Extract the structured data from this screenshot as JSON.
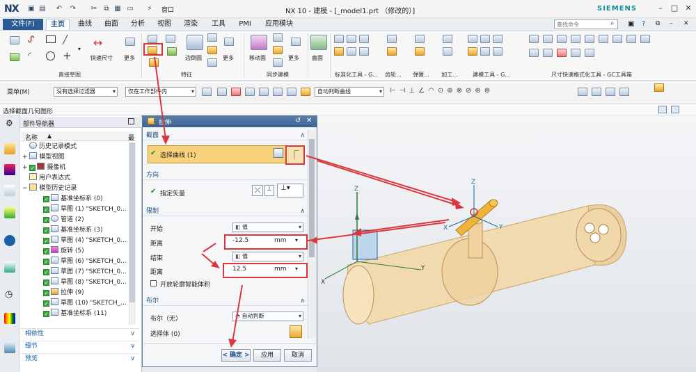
{
  "titlebar": {
    "logo": "NX",
    "title": "NX 10 - 建模 - [_model1.prt （修改的）]",
    "brand": "SIEMENS",
    "window_menu": "窗口"
  },
  "menu": {
    "file": "文件(F)",
    "tabs": [
      "主页",
      "曲线",
      "曲面",
      "分析",
      "视图",
      "渲染",
      "工具",
      "PMI",
      "应用模块"
    ],
    "search_placeholder": "查找命令"
  },
  "ribbon": {
    "groups": [
      "直接草图",
      "特征",
      "同步建模",
      "标准化工具 - G...",
      "齿轮...",
      "弹簧...",
      "加工...",
      "建模工具 - G...",
      "尺寸快速格式化工具 - GC工具箱"
    ],
    "labels": {
      "quick_dim": "快速尺寸",
      "more1": "更多",
      "edge_blend": "边倒圆",
      "more2": "更多",
      "move_face": "移动面",
      "more3": "更多",
      "surface": "曲面"
    }
  },
  "toolbar": {
    "menu": "菜单(M)",
    "filter": "没有选择过滤器",
    "scope": "仅在工作部件内",
    "curve_rule": "自动判断曲线"
  },
  "status": "选择截面几何图形",
  "navigator": {
    "title": "部件导航器",
    "col_name": "名称",
    "col_latest": "最",
    "items": [
      "历史记录模式",
      "模型视图",
      "摄像机",
      "用户表达式",
      "模型历史记录",
      "基准坐标系 (0)",
      "草图 (1) \"SKETCH_0...",
      "管道 (2)",
      "基准坐标系 (3)",
      "草图 (4) \"SKETCH_0...",
      "旋转 (5)",
      "草图 (6) \"SKETCH_0...",
      "草图 (7) \"SKETCH_0...",
      "草图 (8) \"SKETCH_0...",
      "拉伸 (9)",
      "草图 (10) \"SKETCH_...",
      "基准坐标系 (11)"
    ],
    "panels": [
      "相依性",
      "细节",
      "预览"
    ]
  },
  "dialog": {
    "title": "拉伸",
    "section": {
      "header": "截面",
      "select_curve": "选择曲线 (1)"
    },
    "direction": {
      "header": "方向",
      "vector": "指定矢量"
    },
    "limits": {
      "header": "限制",
      "start": "开始",
      "start_value_type": "值",
      "distance1_label": "距离",
      "distance1": "-12.5",
      "unit": "mm",
      "end": "结束",
      "end_value_type": "值",
      "distance2_label": "距离",
      "distance2": "12.5",
      "open_profile": "开放轮廓智能体积"
    },
    "boolean": {
      "header": "布尔",
      "label": "布尔（无）",
      "value": "自动判断",
      "select_body": "选择体 (0)"
    },
    "buttons": {
      "ok": "< 确定 >",
      "apply": "应用",
      "cancel": "取消"
    }
  },
  "colors": {
    "accent": "#2b5b92",
    "highlight": "#d9363e",
    "section": "#1c4c85",
    "model": "#f2d7a4"
  }
}
